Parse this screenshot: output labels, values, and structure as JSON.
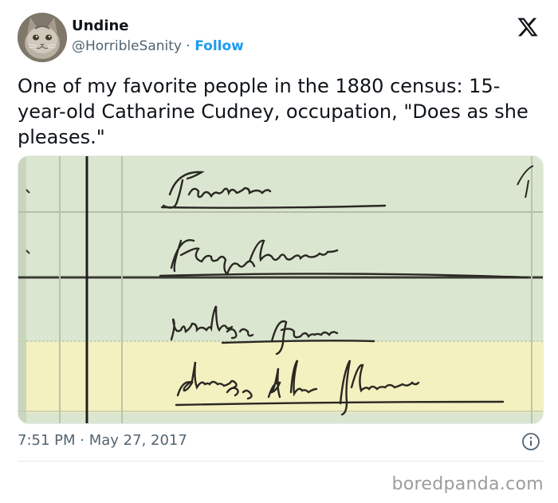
{
  "author": {
    "display_name": "Undine",
    "handle": "@HorribleSanity",
    "separator": "·",
    "follow_label": "Follow"
  },
  "tweet": {
    "text": "One of my favorite people in the 1880 census: 15-year-old Catharine Cudney, occupation, \"Does as she pleases.\"",
    "time": "7:51 PM",
    "time_separator": "·",
    "date": "May 27, 2017"
  },
  "census_image": {
    "entries": [
      "Farmer",
      "Keeps house",
      "Work on farm",
      "does as she pleases"
    ],
    "highlighted_entry": "does as she pleases"
  },
  "icons": {
    "brand": "x-logo-icon",
    "info": "info-icon",
    "avatar": "cat-avatar"
  },
  "colors": {
    "text_primary": "#0f1419",
    "text_secondary": "#536471",
    "link_blue": "#1d9bf0",
    "highlight_row": "#f3f1c0"
  },
  "watermark": "boredpanda.com"
}
